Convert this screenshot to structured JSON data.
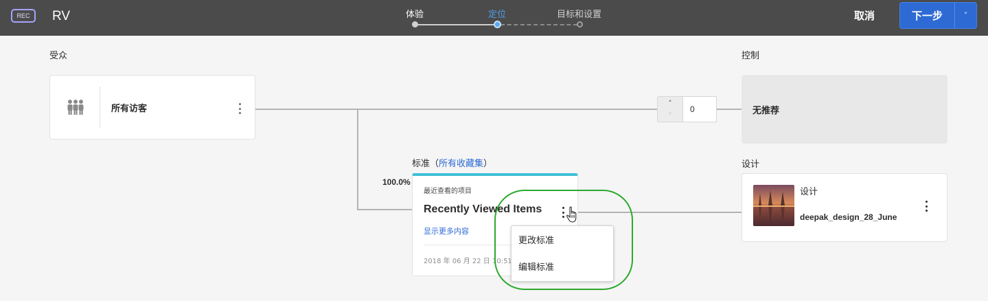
{
  "header": {
    "rec_badge": "REC",
    "title": "RV",
    "steps": [
      {
        "label": "体验",
        "state": "done"
      },
      {
        "label": "定位",
        "state": "active"
      },
      {
        "label": "目标和设置",
        "state": "todo"
      }
    ],
    "cancel_label": "取消",
    "next_label": "下一步"
  },
  "audience": {
    "section_label": "受众",
    "card_name": "所有访客",
    "icon": "people-group-icon"
  },
  "control": {
    "section_label": "控制",
    "traffic_value": "0",
    "card_text": "无推荐"
  },
  "criteria": {
    "header_prefix": "标准（",
    "header_link": "所有收藏集",
    "header_suffix": "）",
    "allocation": "100.0%",
    "type": "最近查看的项目",
    "title": "Recently Viewed Items",
    "show_more": "显示更多内容",
    "date": "2018 年 06 月 22 日 10:51 晚上"
  },
  "context_menu": {
    "items": [
      "更改标准",
      "编辑标准"
    ]
  },
  "design": {
    "section_label": "设计",
    "card_type": "设计",
    "card_name": "deepak_design_28_June"
  },
  "colors": {
    "topbar": "#4b4b4b",
    "accent_blue": "#2d6ad4",
    "criteria_accent": "#3fbfd6",
    "highlight_green": "#2ca82c"
  }
}
